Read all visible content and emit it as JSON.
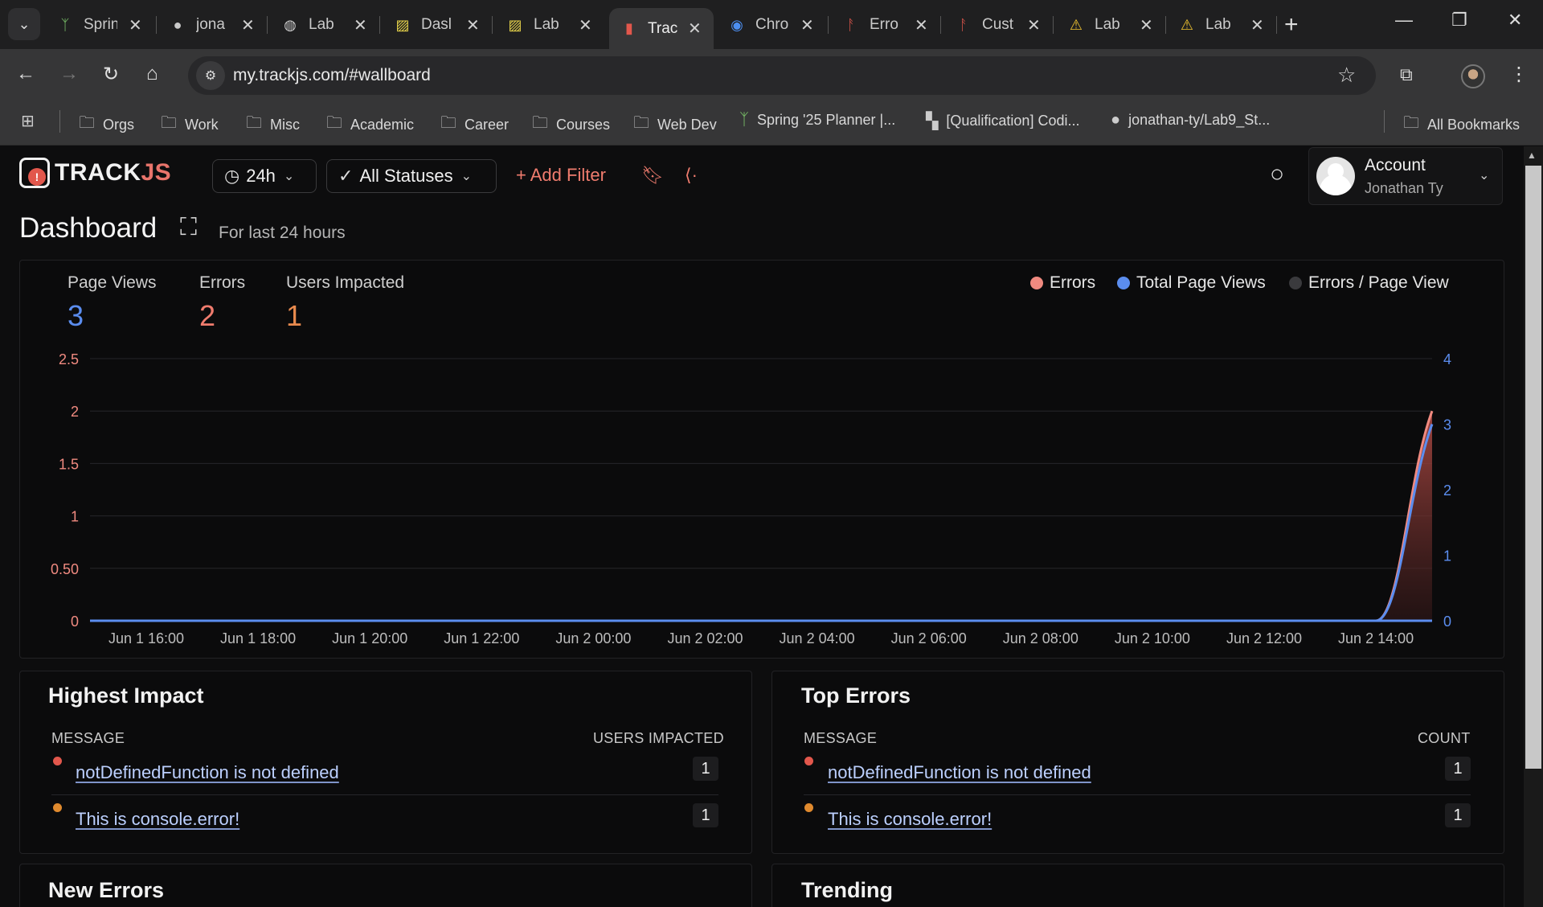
{
  "browser": {
    "tabs": [
      {
        "title": "Sprin",
        "icon": "sprout-icon"
      },
      {
        "title": "jona",
        "icon": "github-icon"
      },
      {
        "title": "Lab",
        "icon": "globe-icon"
      },
      {
        "title": "Dasl",
        "icon": "stripes-icon"
      },
      {
        "title": "Lab",
        "icon": "stripes-icon"
      },
      {
        "title": "Trac",
        "icon": "trackjs-icon",
        "active": true
      },
      {
        "title": "Chro",
        "icon": "chrome-icon"
      },
      {
        "title": "Erro",
        "icon": "figure-icon"
      },
      {
        "title": "Cust",
        "icon": "figure-icon"
      },
      {
        "title": "Lab",
        "icon": "warning-icon"
      },
      {
        "title": "Lab",
        "icon": "warning-icon"
      }
    ],
    "url": "my.trackjs.com/#wallboard",
    "bookmarks": [
      {
        "label": "Orgs",
        "icon": "folder-icon"
      },
      {
        "label": "Work",
        "icon": "folder-icon"
      },
      {
        "label": "Misc",
        "icon": "folder-icon"
      },
      {
        "label": "Academic",
        "icon": "folder-icon"
      },
      {
        "label": "Career",
        "icon": "folder-icon"
      },
      {
        "label": "Courses",
        "icon": "folder-icon"
      },
      {
        "label": "Web Dev",
        "icon": "folder-icon"
      },
      {
        "label": "Spring '25 Planner |...",
        "icon": "sprout-icon"
      },
      {
        "label": "[Qualification] Codi...",
        "icon": "blocks-icon"
      },
      {
        "label": "jonathan-ty/Lab9_St...",
        "icon": "github-icon"
      }
    ],
    "all_bookmarks": "All Bookmarks"
  },
  "app": {
    "logo": {
      "track": "TRACK",
      "js": "JS"
    },
    "time_filter": "24h",
    "status_filter": "All Statuses",
    "add_filter": "+ Add Filter",
    "account": {
      "title": "Account",
      "name": "Jonathan Ty"
    },
    "page_title": "Dashboard",
    "subtitle": "For last 24 hours"
  },
  "stats": [
    {
      "label": "Page Views",
      "value": "3",
      "color": "#5b8def"
    },
    {
      "label": "Errors",
      "value": "2",
      "color": "#f07c6e"
    },
    {
      "label": "Users Impacted",
      "value": "1",
      "color": "#e88a4e"
    }
  ],
  "legend": [
    {
      "label": "Errors",
      "color": "#f08a80"
    },
    {
      "label": "Total Page Views",
      "color": "#5b8def"
    },
    {
      "label": "Errors / Page View",
      "color": "#3a3a3d"
    }
  ],
  "chart_data": {
    "type": "area",
    "x": [
      "Jun 1 16:00",
      "Jun 1 18:00",
      "Jun 1 20:00",
      "Jun 1 22:00",
      "Jun 2 00:00",
      "Jun 2 02:00",
      "Jun 2 04:00",
      "Jun 2 06:00",
      "Jun 2 08:00",
      "Jun 2 10:00",
      "Jun 2 12:00",
      "Jun 2 14:00"
    ],
    "y_left_ticks": [
      "0",
      "0.50",
      "1",
      "1.5",
      "2",
      "2.5"
    ],
    "y_right_ticks": [
      "0",
      "1",
      "2",
      "3",
      "4"
    ],
    "ylim_left": [
      0,
      2.5
    ],
    "ylim_right": [
      0,
      4
    ],
    "series": [
      {
        "name": "Errors",
        "axis": "left",
        "color": "#f08a80",
        "values": [
          0,
          0,
          0,
          0,
          0,
          0,
          0,
          0,
          0,
          0,
          0,
          0,
          2
        ]
      },
      {
        "name": "Total Page Views",
        "axis": "right",
        "color": "#5b8def",
        "values": [
          0,
          0,
          0,
          0,
          0,
          0,
          0,
          0,
          0,
          0,
          0,
          0,
          3
        ]
      }
    ],
    "grid": true
  },
  "highest_impact": {
    "title": "Highest Impact",
    "col_message": "MESSAGE",
    "col_value": "USERS IMPACTED",
    "rows": [
      {
        "message": "notDefinedFunction is not defined",
        "value": "1",
        "dot": "#e2574c"
      },
      {
        "message": "This is console.error!",
        "value": "1",
        "dot": "#e08a2e"
      }
    ]
  },
  "top_errors": {
    "title": "Top Errors",
    "col_message": "MESSAGE",
    "col_value": "COUNT",
    "rows": [
      {
        "message": "notDefinedFunction is not defined",
        "value": "1",
        "dot": "#e2574c"
      },
      {
        "message": "This is console.error!",
        "value": "1",
        "dot": "#e08a2e"
      }
    ]
  },
  "new_errors": {
    "title": "New Errors"
  },
  "trending": {
    "title": "Trending"
  }
}
